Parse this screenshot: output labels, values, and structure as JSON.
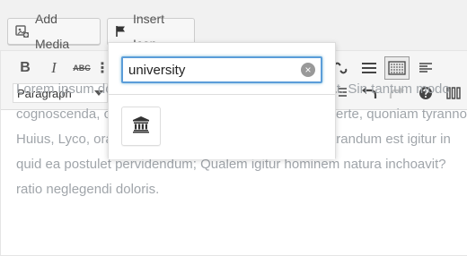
{
  "media_buttons": {
    "add_media_label": "Add Media",
    "insert_icon_label": "Insert Icon"
  },
  "toolbar": {
    "bold": "B",
    "italic": "I",
    "strike": "ABC",
    "list": "⋮",
    "format_value": "Paragraph"
  },
  "icon_popup": {
    "search_value": "university",
    "clear_glyph": "×",
    "results": [
      {
        "icon": "university-icon"
      }
    ]
  },
  "content": {
    "lines": [
      "Lorem ipsum dolor sit amet, consectetur adipiscing elit. Sin tantum modo",
      "cognoscenda, curiosorum. Ille vero, si insipiens-quo certe, quoniam tyranno",
      "Huius, Lyco, oratione locuples, rebus ipsis ielunior. Intrandum est igitur in",
      "quid ea postulet pervidendum; Qualem igitur hominem natura inchoavit?",
      "ratio neglegendi doloris."
    ]
  }
}
